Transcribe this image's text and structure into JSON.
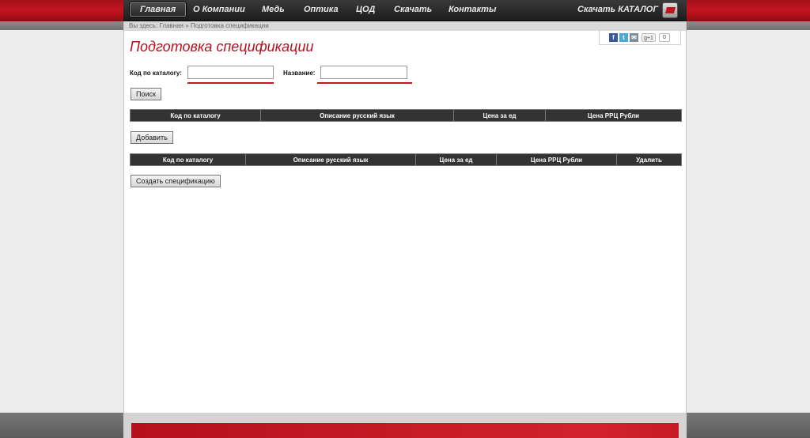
{
  "nav": {
    "items": [
      {
        "label": "Главная",
        "active": true
      },
      {
        "label": "О Компании",
        "active": false
      },
      {
        "label": "Медь",
        "active": false
      },
      {
        "label": "Оптика",
        "active": false
      },
      {
        "label": "ЦОД",
        "active": false
      },
      {
        "label": "Скачать",
        "active": false
      },
      {
        "label": "Контакты",
        "active": false
      }
    ],
    "catalog_label": "Скачать КАТАЛОГ",
    "catalog_icon": "catalog-download-icon"
  },
  "breadcrumb": "Вы здесь: Главная » Подготовка спецификации",
  "share": {
    "facebook": "f",
    "twitter": "t",
    "mail": "✉",
    "gplus": "g+1",
    "count": "0"
  },
  "page": {
    "title": "Подготовка спецификации"
  },
  "search": {
    "code_label": "Код по каталогу:",
    "code_value": "",
    "name_label": "Название:",
    "name_value": "",
    "button": "Поиск"
  },
  "results_table": {
    "columns": [
      "Код по каталогу",
      "Описание русский язык",
      "Цена за ед",
      "Цена РРЦ Рубли"
    ],
    "rows": []
  },
  "add_button": "Добавить",
  "spec_table": {
    "columns": [
      "Код по каталогу",
      "Описание русский язык",
      "Цена за ед",
      "Цена РРЦ Рубли",
      "Удалить"
    ],
    "rows": []
  },
  "create_button": "Создать спецификацию",
  "colors": {
    "brand_red": "#c3151f",
    "nav_dark": "#1c1c1c",
    "table_header": "#333333"
  }
}
